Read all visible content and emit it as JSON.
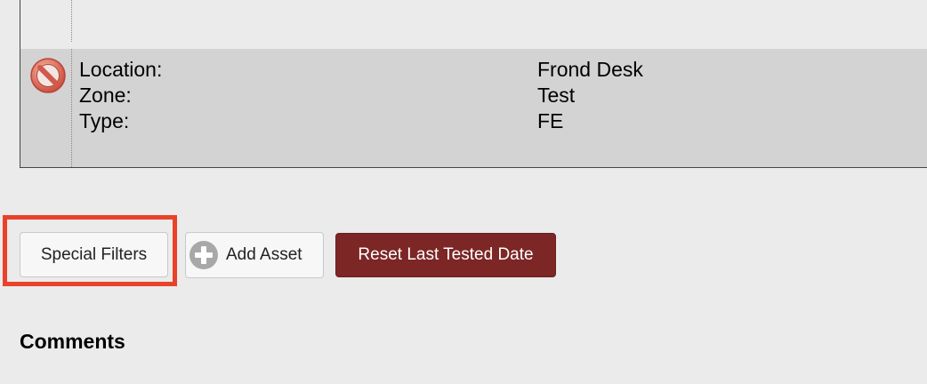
{
  "asset": {
    "status_icon": "prohibited-icon",
    "fields": [
      {
        "label": "Location:",
        "value": "Frond Desk"
      },
      {
        "label": "Zone:",
        "value": "Test"
      },
      {
        "label": "Type:",
        "value": "FE"
      }
    ]
  },
  "toolbar": {
    "special_filters_label": "Special Filters",
    "add_asset_label": "Add Asset",
    "add_asset_icon": "plus-circle-icon",
    "reset_label": "Reset Last Tested Date"
  },
  "colors": {
    "highlight": "#e8432a",
    "reset_button": "#7d2626",
    "row_background": "#d3d3d3",
    "page_background": "#ebebeb"
  },
  "comments": {
    "heading": "Comments"
  }
}
